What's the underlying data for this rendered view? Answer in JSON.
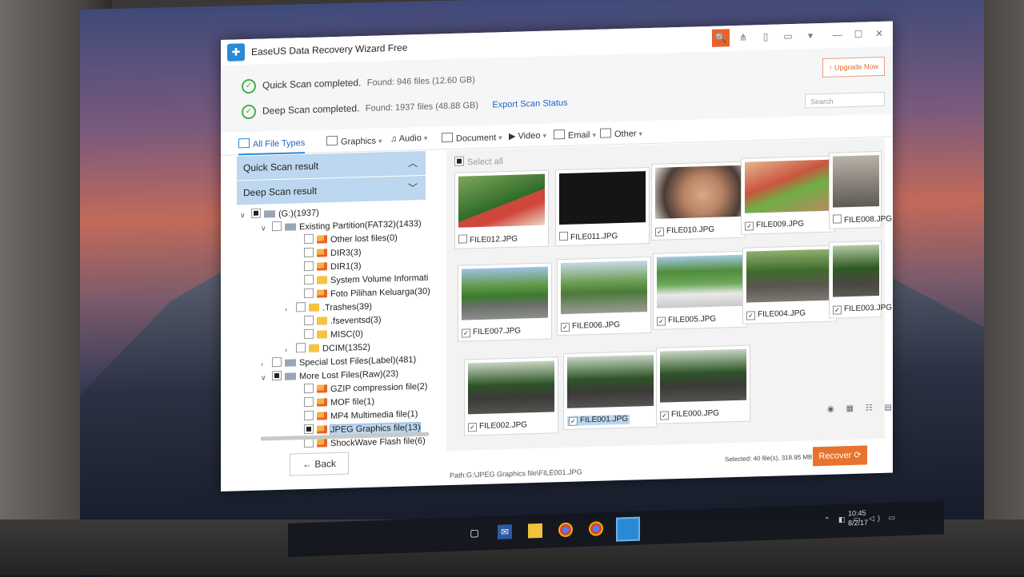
{
  "window": {
    "title": "EaseUS Data Recovery Wizard Free",
    "logo_icon": "easeus-app-icon"
  },
  "titlebar_buttons": {
    "search": "🔍",
    "share": "⋔",
    "bookmark": "▯",
    "feedback": "▭",
    "menu": "▾",
    "minimize": "—",
    "maximize": "☐",
    "close": "✕"
  },
  "status": {
    "quick_scan": {
      "label": "Quick Scan completed.",
      "found": "Found: 946 files (12.60 GB)"
    },
    "deep_scan": {
      "label": "Deep Scan completed.",
      "found": "Found: 1937 files (48.88 GB)"
    },
    "export_link": "Export Scan Status",
    "upgrade_button": "↑ Upgrade Now",
    "search_placeholder": "Search"
  },
  "filters": {
    "all": "All File Types",
    "graphics": "Graphics",
    "audio": "Audio",
    "document": "Document",
    "video": "Video",
    "email": "Email",
    "other": "Other"
  },
  "left_panel": {
    "quick_result": "Quick Scan result",
    "deep_result": "Deep Scan result",
    "tree": [
      {
        "label": "(G:)(1937)"
      },
      {
        "label": "Existing Partition(FAT32)(1433)"
      },
      {
        "label": "Other lost files(0)"
      },
      {
        "label": "DIR3(3)"
      },
      {
        "label": "DIR1(3)"
      },
      {
        "label": "System Volume Informati"
      },
      {
        "label": "Foto Pilihan Keluarga(30)"
      },
      {
        "label": ".Trashes(39)"
      },
      {
        "label": ".fseventsd(3)"
      },
      {
        "label": "MISC(0)"
      },
      {
        "label": "DCIM(1352)"
      },
      {
        "label": "Special Lost Files(Label)(481)"
      },
      {
        "label": "More Lost Files(Raw)(23)"
      },
      {
        "label": "GZIP compression file(2)"
      },
      {
        "label": "MOF file(1)"
      },
      {
        "label": "MP4 Multimedia file(1)"
      },
      {
        "label": "JPEG Graphics file(13)"
      },
      {
        "label": "ShockWave Flash file(6)"
      }
    ],
    "back_button": "← Back"
  },
  "grid": {
    "select_all": "Select all",
    "files": [
      {
        "name": "FILE012.JPG",
        "checked": false
      },
      {
        "name": "FILE011.JPG",
        "checked": false
      },
      {
        "name": "FILE010.JPG",
        "checked": true
      },
      {
        "name": "FILE009.JPG",
        "checked": true
      },
      {
        "name": "FILE008.JPG",
        "checked": false
      },
      {
        "name": "FILE007.JPG",
        "checked": true
      },
      {
        "name": "FILE006.JPG",
        "checked": true
      },
      {
        "name": "FILE005.JPG",
        "checked": true
      },
      {
        "name": "FILE004.JPG",
        "checked": true
      },
      {
        "name": "FILE003.JPG",
        "checked": true
      },
      {
        "name": "FILE002.JPG",
        "checked": true
      },
      {
        "name": "FILE001.JPG",
        "checked": true
      },
      {
        "name": "FILE000.JPG",
        "checked": true
      }
    ],
    "view_tools": "◉ ▦ ☷ ▤"
  },
  "footer": {
    "path": "Path:G:\\JPEG Graphics file\\FILE001.JPG",
    "selected": "Selected: 40 file(s), 318.95 MB",
    "recover_button": "Recover ⟳"
  },
  "taskbar": {
    "clock_time": "10:45",
    "clock_date": "8/2/17",
    "tray_icons": "⌃ ◧ ▭ ◁) ▭"
  }
}
